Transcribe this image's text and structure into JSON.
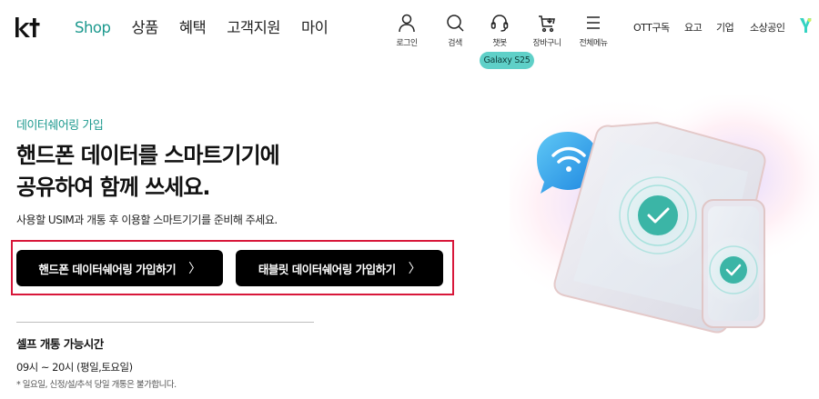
{
  "header": {
    "brand": "kt",
    "nav": [
      {
        "label": "Shop",
        "active": true
      },
      {
        "label": "상품"
      },
      {
        "label": "혜택"
      },
      {
        "label": "고객지원"
      },
      {
        "label": "마이"
      }
    ],
    "utilities": [
      {
        "label": "로그인",
        "icon": "user-icon"
      },
      {
        "label": "검색",
        "icon": "search-icon"
      },
      {
        "label": "챗봇",
        "icon": "headset-icon"
      },
      {
        "label": "장바구니",
        "icon": "cart-icon"
      },
      {
        "label": "전체메뉴",
        "icon": "menu-icon"
      }
    ],
    "links": [
      "OTT구독",
      "요고",
      "기업",
      "소상공인"
    ],
    "promo_badge": "Galaxy S25"
  },
  "main": {
    "eyebrow": "데이터쉐어링 가입",
    "headline_line1": "핸드폰 데이터를 스마트기기에",
    "headline_line2": "공유하여 함께 쓰세요.",
    "description": "사용할 USIM과 개통 후 이용할 스마트기기를 준비해 주세요.",
    "buttons": {
      "phone": "핸드폰 데이터쉐어링 가입하기",
      "tablet": "태블릿 데이터쉐어링 가입하기",
      "chevron": "〉"
    },
    "hours": {
      "title": "셀프 개통 가능시간",
      "time": "09시 ~ 20시 (평일,토요일)",
      "note": "* 일요일, 신정/설/추석 당일 개통은 불가합니다."
    }
  },
  "colors": {
    "accent": "#1e9a8f",
    "promo": "#5fd0c8",
    "button": "#000000",
    "highlight_border": "#d8173a"
  }
}
